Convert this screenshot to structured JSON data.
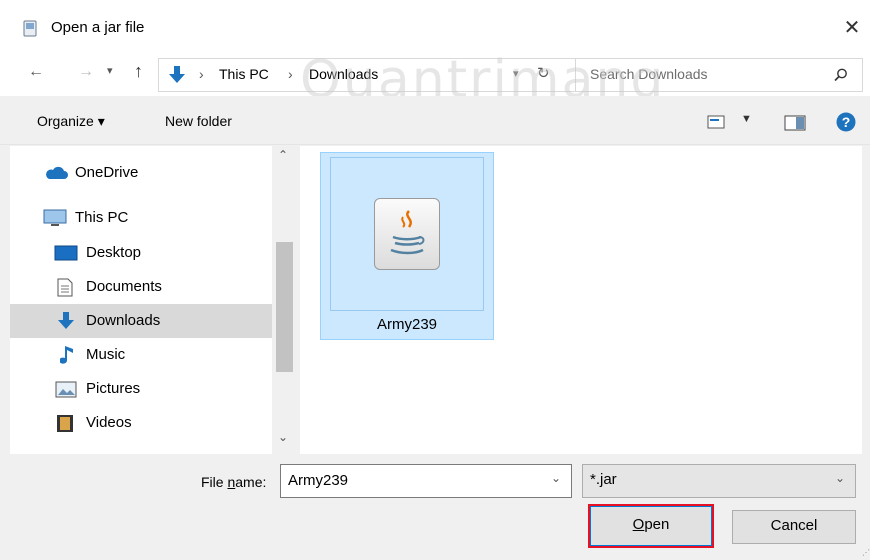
{
  "window": {
    "title": "Open a jar file",
    "close_glyph": "✕"
  },
  "nav": {
    "breadcrumb": [
      "This PC",
      "Downloads"
    ],
    "search_placeholder": "Search Downloads"
  },
  "toolbar": {
    "organize": "Organize ▾",
    "new_folder": "New folder"
  },
  "navpane": {
    "items": [
      {
        "label": "OneDrive",
        "icon": "cloud-icon"
      },
      {
        "label": "This PC",
        "icon": "computer-icon"
      },
      {
        "label": "Desktop",
        "icon": "desktop-icon"
      },
      {
        "label": "Documents",
        "icon": "document-icon"
      },
      {
        "label": "Downloads",
        "icon": "download-icon",
        "selected": true
      },
      {
        "label": "Music",
        "icon": "music-icon"
      },
      {
        "label": "Pictures",
        "icon": "picture-icon"
      },
      {
        "label": "Videos",
        "icon": "video-icon"
      }
    ]
  },
  "content": {
    "files": [
      {
        "name": "Army239",
        "icon": "java-icon"
      }
    ]
  },
  "bottom": {
    "file_name_label": "File name:",
    "file_name_value": "Army239",
    "file_type": "*.jar",
    "open": "Open",
    "cancel": "Cancel"
  },
  "watermark": "Quantrimang",
  "colors": {
    "accent": "#0078d7",
    "selection": "#cce8ff",
    "highlight_outline": "#e81123"
  }
}
